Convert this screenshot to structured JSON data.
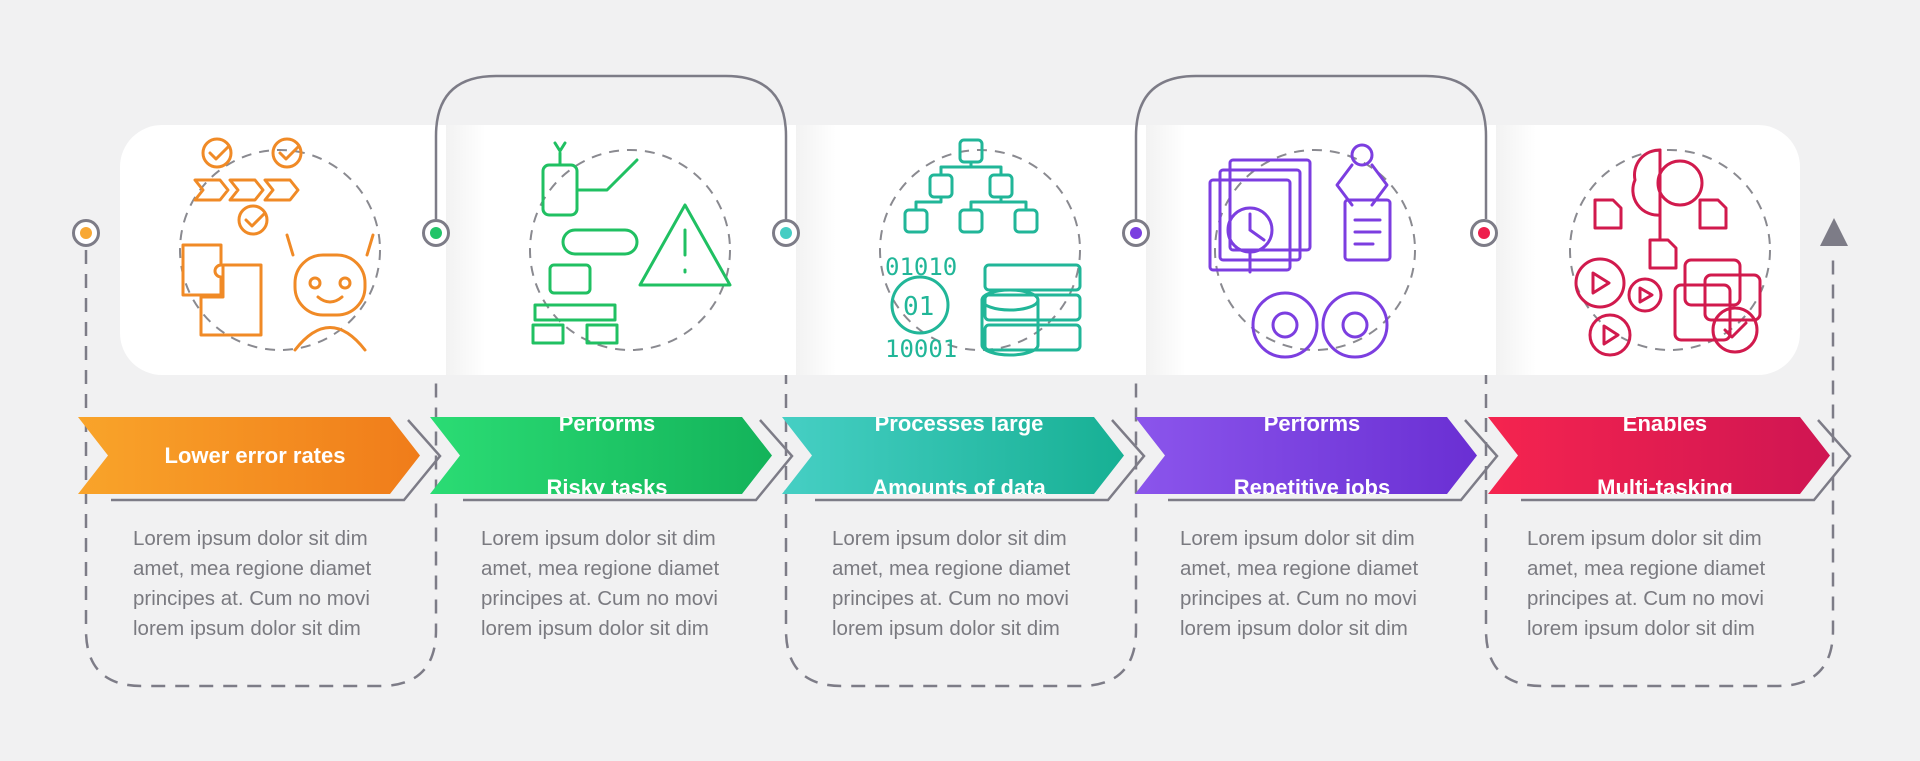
{
  "steps": [
    {
      "title_line1": "Lower error rates",
      "title_line2": "",
      "body": "Lorem ipsum dolor sit dim amet, mea regione diamet principes at. Cum no movi lorem ipsum dolor sit dim",
      "icon": "error-reduction-robot-icon",
      "color_start": "#f9a42a",
      "color_end": "#f07c1a",
      "icon_color": "#f08a26",
      "dot_color": "#f8a834"
    },
    {
      "title_line1": "Performs",
      "title_line2": "Risky tasks",
      "body": "Lorem ipsum dolor sit dim amet, mea regione diamet principes at. Cum no movi lorem ipsum dolor sit dim",
      "icon": "risky-tasks-robot-icon",
      "color_start": "#2bdc74",
      "color_end": "#13b35a",
      "icon_color": "#20c062",
      "dot_color": "#22c468"
    },
    {
      "title_line1": "Processes large",
      "title_line2": "Amounts of data",
      "body": "Lorem ipsum dolor sit dim amet, mea regione diamet principes at. Cum no movi lorem ipsum dolor sit dim",
      "icon": "big-data-icon",
      "color_start": "#46cfc4",
      "color_end": "#17b094",
      "icon_color": "#21b698",
      "dot_color": "#45cdc3"
    },
    {
      "title_line1": "Performs",
      "title_line2": "Repetitive jobs",
      "body": "Lorem ipsum dolor sit dim amet, mea regione diamet principes at. Cum no movi lorem ipsum dolor sit dim",
      "icon": "repetitive-jobs-icon",
      "color_start": "#8b55ec",
      "color_end": "#6a2fd3",
      "icon_color": "#7c3ee0",
      "dot_color": "#7a3fe0"
    },
    {
      "title_line1": "Enables",
      "title_line2": "Multi-tasking",
      "body": "Lorem ipsum dolor sit dim amet, mea regione diamet principes at. Cum no movi lorem ipsum dolor sit dim",
      "icon": "multitasking-brain-icon",
      "color_start": "#f5244f",
      "color_end": "#cf1552",
      "icon_color": "#d11a4d",
      "dot_color": "#ee1f4c"
    }
  ],
  "connector_color": "#7d7c87"
}
